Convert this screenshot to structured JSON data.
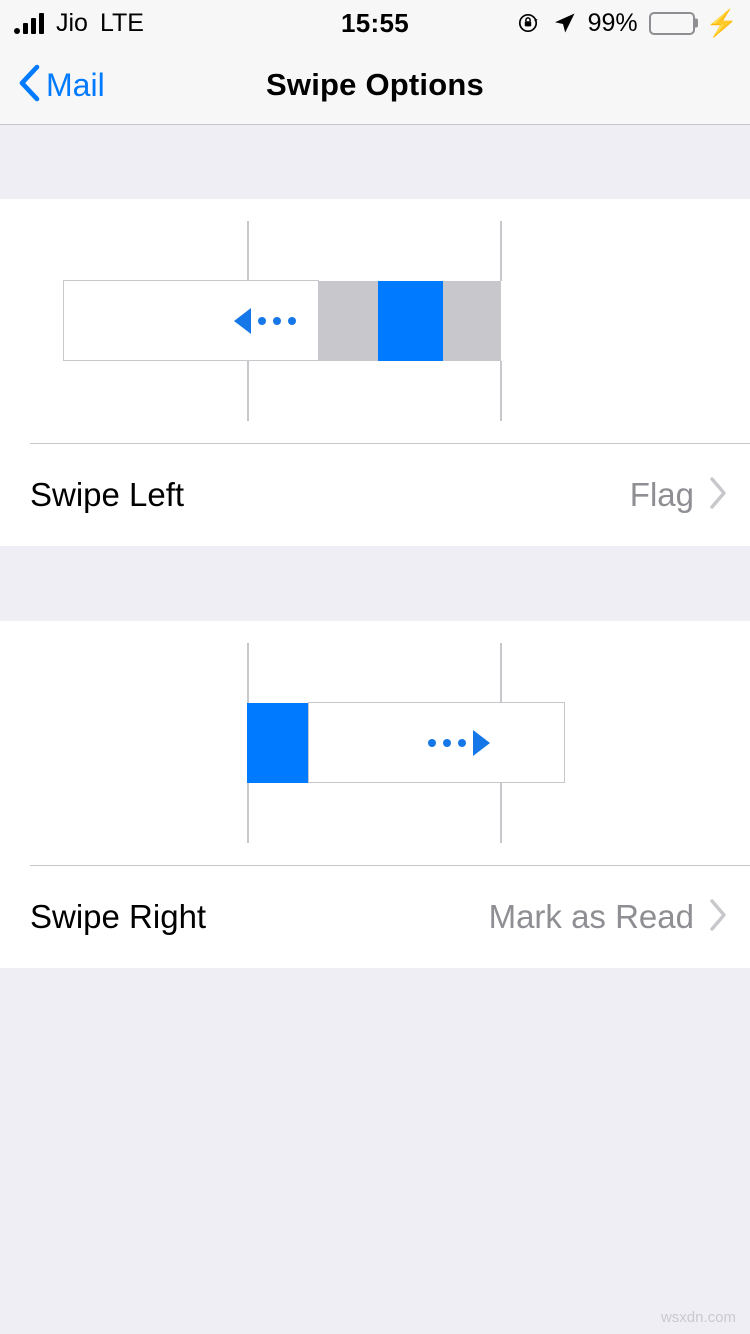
{
  "status_bar": {
    "carrier": "Jio",
    "network": "LTE",
    "time": "15:55",
    "battery_percent": "99%",
    "battery_level": 99,
    "icons": {
      "signal": "signal-bars-icon",
      "rotation_lock": "rotation-lock-icon",
      "location": "location-arrow-icon",
      "battery": "battery-icon",
      "charging": "charging-bolt-icon"
    }
  },
  "nav": {
    "back_label": "Mail",
    "back_icon": "chevron-left-icon",
    "title": "Swipe Options"
  },
  "sections": [
    {
      "illustration": {
        "name": "swipe-left-illustration",
        "direction": "left",
        "arrow_icon": "arrow-left-ellipsis-icon",
        "blocks": [
          {
            "name": "message-cell",
            "color": "#FFFFFF"
          },
          {
            "name": "action-track-gray",
            "color": "#C7C7CC"
          },
          {
            "name": "action-highlight-blue",
            "color": "#007AFF"
          }
        ]
      },
      "row": {
        "name": "swipe-left-row",
        "label": "Swipe Left",
        "value": "Flag",
        "chevron": "chevron-right-icon"
      }
    },
    {
      "illustration": {
        "name": "swipe-right-illustration",
        "direction": "right",
        "arrow_icon": "arrow-right-ellipsis-icon",
        "blocks": [
          {
            "name": "action-highlight-blue",
            "color": "#007AFF"
          },
          {
            "name": "message-cell",
            "color": "#FFFFFF"
          }
        ]
      },
      "row": {
        "name": "swipe-right-row",
        "label": "Swipe Right",
        "value": "Mark as Read",
        "chevron": "chevron-right-icon"
      }
    }
  ],
  "colors": {
    "accent_blue": "#007AFF",
    "arrow_blue": "#1677E8",
    "track_gray": "#C7C7CC",
    "separator": "#C8C7CC",
    "group_background": "#EFEEF4",
    "bar_background": "#F7F7F7",
    "value_text": "#8E8E93",
    "battery_green": "#4CD964"
  },
  "watermark": "wsxdn.com"
}
